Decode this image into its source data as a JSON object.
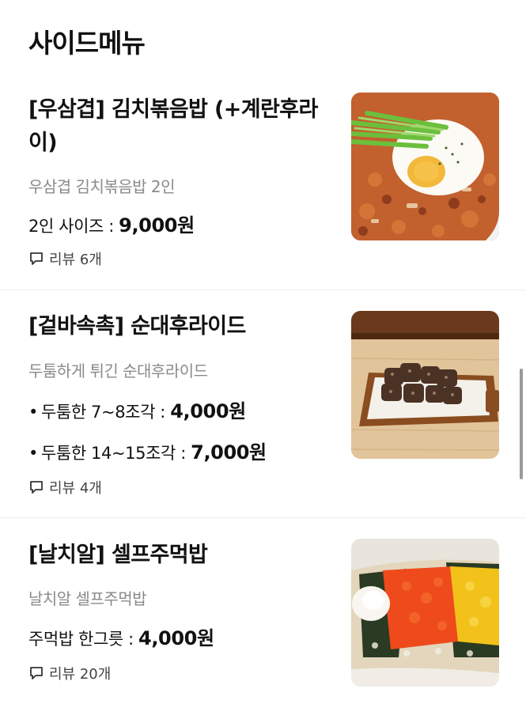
{
  "section": {
    "title": "사이드메뉴"
  },
  "items": [
    {
      "name_line1": "[우삼겹] 김치볶음밥 (+계란후라",
      "name_line2": "이)",
      "desc": "우삼겹 김치볶음밥 2인",
      "prices": [
        {
          "label": "2인 사이즈 : ",
          "amount": "9,000원",
          "bullet": ""
        }
      ],
      "review_label": "리뷰 6개",
      "image_icon": "kimchi-fried-rice-photo"
    },
    {
      "name_line1": "[겉바속촉] 순대후라이드",
      "desc": "두툼하게 튀긴 순대후라이드",
      "prices": [
        {
          "label": "두툼한 7~8조각 : ",
          "amount": "4,000원",
          "bullet": "•"
        },
        {
          "label": "두툼한 14~15조각 : ",
          "amount": "7,000원",
          "bullet": "•"
        }
      ],
      "review_label": "리뷰 4개",
      "image_icon": "fried-sundae-photo"
    },
    {
      "name_line1": "[날치알] 셀프주먹밥",
      "desc": "날치알 셀프주먹밥",
      "prices": [
        {
          "label": "주먹밥 한그릇 : ",
          "amount": "4,000원",
          "bullet": ""
        }
      ],
      "review_label": "리뷰 20개",
      "image_icon": "rice-ball-photo"
    }
  ],
  "colors": {
    "text": "#111111",
    "muted": "#8a8a8a",
    "divider": "#eeeeee"
  }
}
